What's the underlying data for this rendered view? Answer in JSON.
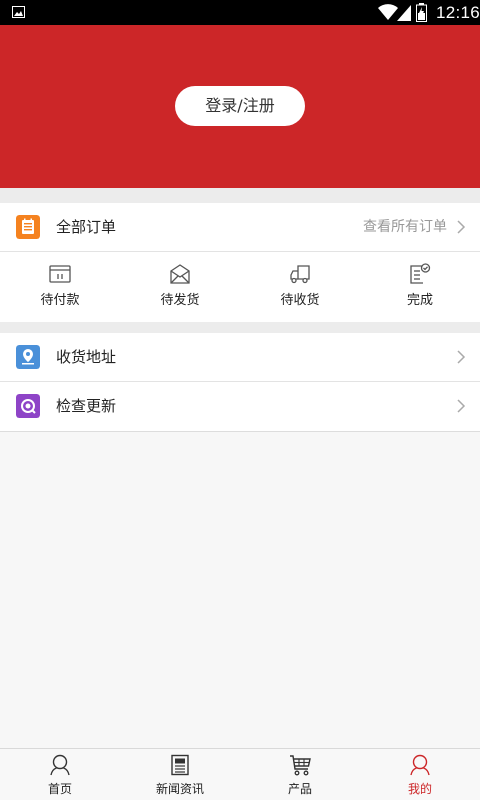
{
  "status_bar": {
    "time": "12:16",
    "icons": [
      "gallery-icon",
      "wifi-icon",
      "signal-icon",
      "battery-icon"
    ]
  },
  "header": {
    "background": "#cc2628",
    "login_label": "登录/注册"
  },
  "orders": {
    "title": "全部订单",
    "view_all": "查看所有订单",
    "icon": "orders-icon",
    "icon_color": "#f5821f",
    "statuses": [
      {
        "label": "待付款",
        "icon": "wallet-icon"
      },
      {
        "label": "待发货",
        "icon": "package-icon"
      },
      {
        "label": "待收货",
        "icon": "truck-icon"
      },
      {
        "label": "完成",
        "icon": "completed-icon"
      }
    ]
  },
  "menu": [
    {
      "label": "收货地址",
      "icon": "location-icon",
      "icon_color": "#4a90d9"
    },
    {
      "label": "检查更新",
      "icon": "update-icon",
      "icon_color": "#8e44c7"
    }
  ],
  "bottom_nav": {
    "active_color": "#cc2628",
    "items": [
      {
        "label": "首页",
        "icon": "home-icon",
        "active": false
      },
      {
        "label": "新闻资讯",
        "icon": "news-icon",
        "active": false
      },
      {
        "label": "产品",
        "icon": "cart-icon",
        "active": false
      },
      {
        "label": "我的",
        "icon": "profile-icon",
        "active": true
      }
    ]
  }
}
